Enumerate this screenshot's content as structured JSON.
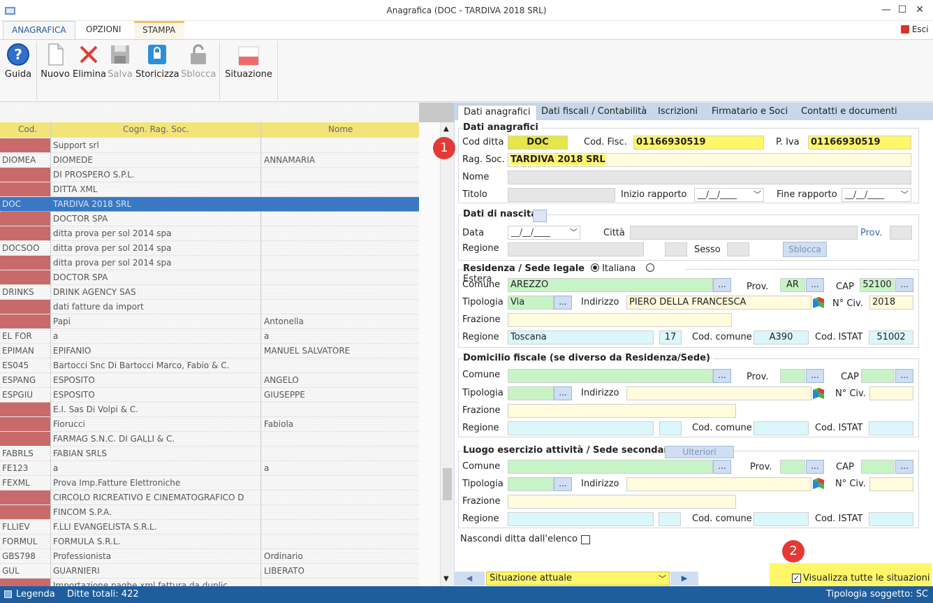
{
  "window": {
    "title": "Anagrafica (DOC - TARDIVA 2018 SRL)",
    "min": "—",
    "max": "☐",
    "close": "✕"
  },
  "ribbon_tabs": [
    "ANAGRAFICA",
    "OPZIONI",
    "STAMPA"
  ],
  "exit_label": "Esci",
  "ribbon": {
    "guida": "Guida",
    "nuovo": "Nuovo",
    "elimina": "Elimina",
    "salva": "Salva",
    "storicizza": "Storicizza",
    "sblocca": "Sblocca",
    "situazione": "Situazione"
  },
  "grid": {
    "headers": [
      "Cod.",
      "Cogn. Rag. Soc.",
      "Nome"
    ],
    "rows": [
      {
        "c1": "",
        "c2": "Support srl",
        "c3": "",
        "red": true
      },
      {
        "c1": "DIOMEA",
        "c2": "DIOMEDE",
        "c3": "ANNAMARIA",
        "red": false
      },
      {
        "c1": "",
        "c2": "DI PROSPERO S.P.L.",
        "c3": "",
        "red": true
      },
      {
        "c1": "",
        "c2": "DITTA XML",
        "c3": "",
        "red": true
      },
      {
        "c1": "DOC",
        "c2": "TARDIVA 2018 SRL",
        "c3": "",
        "red": false,
        "sel": true
      },
      {
        "c1": "",
        "c2": "DOCTOR SPA",
        "c3": "",
        "red": true
      },
      {
        "c1": "",
        "c2": "ditta prova per sol 2014 spa",
        "c3": "",
        "red": true
      },
      {
        "c1": "DOCSOO",
        "c2": "ditta prova per sol 2014 spa",
        "c3": "",
        "red": false
      },
      {
        "c1": "",
        "c2": "ditta prova per sol 2014 spa",
        "c3": "",
        "red": true
      },
      {
        "c1": "",
        "c2": "DOCTOR SPA",
        "c3": "",
        "red": true
      },
      {
        "c1": "DRINKS",
        "c2": "DRINK AGENCY SAS",
        "c3": "",
        "red": false
      },
      {
        "c1": "",
        "c2": "dati fatture da import",
        "c3": "",
        "red": true
      },
      {
        "c1": "",
        "c2": "Papi",
        "c3": "Antonella",
        "red": true
      },
      {
        "c1": "EL FOR",
        "c2": "a",
        "c3": "a",
        "red": false
      },
      {
        "c1": "EPIMAN",
        "c2": "EPIFANIO",
        "c3": "MANUEL SALVATORE",
        "red": false
      },
      {
        "c1": "ES045",
        "c2": "Bartocci Snc Di Bartocci Marco, Fabio & C.",
        "c3": "",
        "red": false
      },
      {
        "c1": "ESPANG",
        "c2": "ESPOSITO",
        "c3": "ANGELO",
        "red": false
      },
      {
        "c1": "ESPGIU",
        "c2": "ESPOSITO",
        "c3": "GIUSEPPE",
        "red": false
      },
      {
        "c1": "",
        "c2": "E.I. Sas Di Volpi & C.",
        "c3": "",
        "red": true
      },
      {
        "c1": "",
        "c2": "Fiorucci",
        "c3": "Fabiola",
        "red": true
      },
      {
        "c1": "",
        "c2": "FARMAG S.N.C. DI GALLI & C.",
        "c3": "",
        "red": true
      },
      {
        "c1": "FABRLS",
        "c2": "FABIAN SRLS",
        "c3": "",
        "red": false
      },
      {
        "c1": "FE123",
        "c2": "a",
        "c3": "a",
        "red": false
      },
      {
        "c1": "FEXML",
        "c2": "Prova Imp.Fatture Elettroniche",
        "c3": "",
        "red": false
      },
      {
        "c1": "",
        "c2": "CIRCOLO RICREATIVO E CINEMATOGRAFICO D",
        "c3": "",
        "red": true
      },
      {
        "c1": "",
        "c2": "FINCOM S.P.A.",
        "c3": "",
        "red": true
      },
      {
        "c1": "FLLIEV",
        "c2": "F.LLI EVANGELISTA S.R.L.",
        "c3": "",
        "red": false
      },
      {
        "c1": "FORMUL",
        "c2": "FORMULA S.R.L.",
        "c3": "",
        "red": false
      },
      {
        "c1": "GBS798",
        "c2": "Professionista",
        "c3": "Ordinario",
        "red": false
      },
      {
        "c1": "GUL",
        "c2": "GUARNIERI",
        "c3": "LIBERATO",
        "red": false
      },
      {
        "c1": "",
        "c2": "Importazione paghe xml fattura da duplic.",
        "c3": "",
        "red": true
      }
    ]
  },
  "tabs": [
    "Dati anagrafici",
    "Dati fiscali / Contabilità",
    "Iscrizioni",
    "Firmatario e Soci",
    "Contatti e documenti"
  ],
  "dati_anagrafici": {
    "title": "Dati anagrafici",
    "cod_ditta_label": "Cod ditta",
    "cod_ditta": "DOC",
    "cod_fisc_label": "Cod. Fisc.",
    "cod_fisc": "01166930519",
    "piva_label": "P. Iva",
    "piva": "01166930519",
    "rag_soc_label": "Rag. Soc.",
    "rag_soc": "TARDIVA 2018 SRL",
    "nome_label": "Nome",
    "titolo_label": "Titolo",
    "inizio_label": "Inizio rapporto",
    "fine_label": "Fine rapporto",
    "date_empty": "__/__/____"
  },
  "nascita": {
    "title": "Dati di nascita",
    "data_label": "Data",
    "citta_label": "Città",
    "prov_label": "Prov.",
    "regione_label": "Regione",
    "sesso_label": "Sesso",
    "sblocca": "Sblocca"
  },
  "residenza": {
    "title": "Residenza / Sede legale",
    "italiana": "Italiana",
    "estera": "Estera",
    "comune_label": "Comune",
    "comune": "AREZZO",
    "prov_label": "Prov.",
    "prov": "AR",
    "cap_label": "CAP",
    "cap": "52100",
    "tipologia_label": "Tipologia",
    "tipologia": "Via",
    "indirizzo_label": "Indirizzo",
    "indirizzo": "PIERO DELLA FRANCESCA",
    "civ_label": "N° Civ.",
    "civ": "2018",
    "frazione_label": "Frazione",
    "regione_label": "Regione",
    "regione": "Toscana",
    "reg_code": "17",
    "cod_comune_label": "Cod. comune",
    "cod_comune": "A390",
    "istat_label": "Cod. ISTAT",
    "istat": "51002"
  },
  "domicilio": {
    "title": "Domicilio fiscale (se diverso da Residenza/Sede)"
  },
  "luogo": {
    "title": "Luogo esercizio attività / Sede secondaria",
    "ulteriori": "Ulteriori"
  },
  "common": {
    "comune": "Comune",
    "prov": "Prov.",
    "cap": "CAP",
    "tipologia": "Tipologia",
    "indirizzo": "Indirizzo",
    "civ": "N° Civ.",
    "frazione": "Frazione",
    "regione": "Regione",
    "cod_comune": "Cod. comune",
    "istat": "Cod. ISTAT",
    "dots": "..."
  },
  "nascondi_label": "Nascondi ditta dall'elenco",
  "situazione": "Situazione attuale",
  "visualizza": "Visualizza tutte le situazioni",
  "badges": [
    "1",
    "2"
  ],
  "status": {
    "legenda": "Legenda",
    "ditte": "Ditte totali: 422",
    "tipologia": "Tipologia soggetto: SC"
  }
}
